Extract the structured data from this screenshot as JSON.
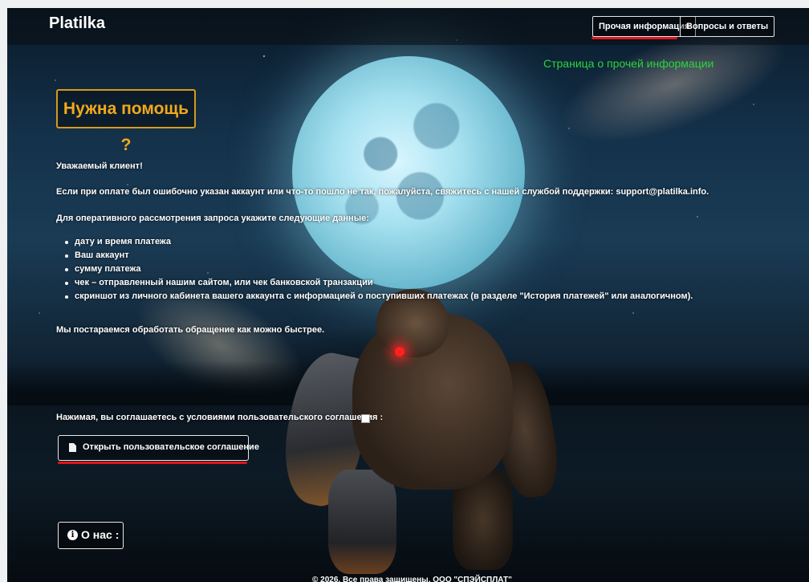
{
  "header": {
    "logo": "Platilka",
    "nav": {
      "other_info": "Прочая информация",
      "faq": "Вопросы и ответы"
    }
  },
  "annotation": "Страница о прочей информации",
  "help": {
    "title": "Нужна помощь ?"
  },
  "content": {
    "greeting": "Уважаемый клиент!",
    "paragraph1": "Если при оплате был ошибочно указан аккаунт или что-то пошло не так, пожалуйста, свяжитесь с нашей службой поддержки: support@platilka.info.",
    "paragraph2": "Для оперативного рассмотрения запроса укажите следующие данные:",
    "items": [
      "дату и время платежа",
      "Ваш аккаунт",
      "сумму платежа",
      "чек – отправленный нашим сайтом, или чек банковской транзакции",
      "скриншот из личного кабинета вашего аккаунта с информацией о поступивших платежах (в разделе \"История платежей\" или аналогичном)."
    ],
    "closing": "Мы постараемся обработать обращение как можно быстрее."
  },
  "agreement": {
    "consent_text": "Нажимая, вы соглашаетесь с условиями пользовательского соглашения :",
    "checked": false,
    "open_button": "Открыть пользовательское соглашение"
  },
  "about": {
    "label": "О нас :"
  },
  "footer": {
    "copyright": "© 2026. Все права защищены. ООО \"СПЭЙСПЛАТ\""
  },
  "colors": {
    "accent_orange": "#f3a91a",
    "annotation_green": "#28d63a",
    "underline_red": "#e0151b"
  },
  "icons": {
    "document": "document-icon",
    "info": "info-circle-icon"
  }
}
